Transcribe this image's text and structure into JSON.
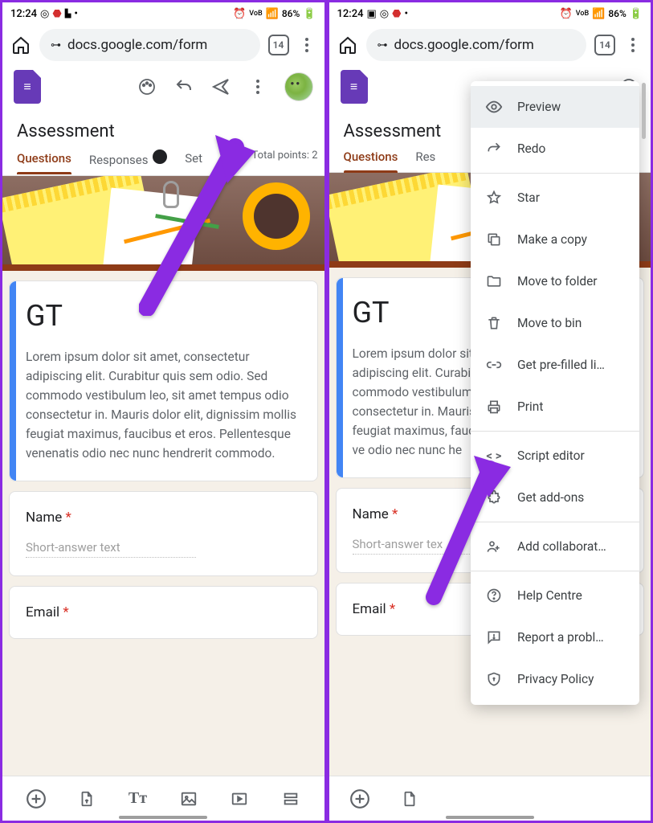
{
  "status": {
    "time": "12:24",
    "battery": "86%"
  },
  "browser": {
    "url": "docs.google.com/form",
    "tab_count": "14"
  },
  "forms": {
    "title": "Assessment"
  },
  "tabs": {
    "questions": "Questions",
    "responses": "Responses",
    "settings": "Set",
    "points": "Total points: 2"
  },
  "card1": {
    "heading": "GT",
    "body": "Lorem ipsum dolor sit amet, consectetur adipiscing elit. Curabitur quis sem odio. Sed commodo vestibulum leo, sit amet tempus odio consectetur in. Mauris dolor elit, dignissim mollis feugiat maximus, faucibus et eros. Pellentesque venenatis odio nec nunc hendrerit commodo."
  },
  "q1": {
    "label": "Name",
    "placeholder": "Short-answer text"
  },
  "q2": {
    "label": "Email"
  },
  "menu": {
    "preview": "Preview",
    "redo": "Redo",
    "star": "Star",
    "copy": "Make a copy",
    "move": "Move to folder",
    "bin": "Move to bin",
    "prefill": "Get pre-filled li…",
    "print": "Print",
    "script": "Script editor",
    "addons": "Get add-ons",
    "collab": "Add collaborat…",
    "help": "Help Centre",
    "report": "Report a probl…",
    "privacy": "Privacy Policy"
  }
}
